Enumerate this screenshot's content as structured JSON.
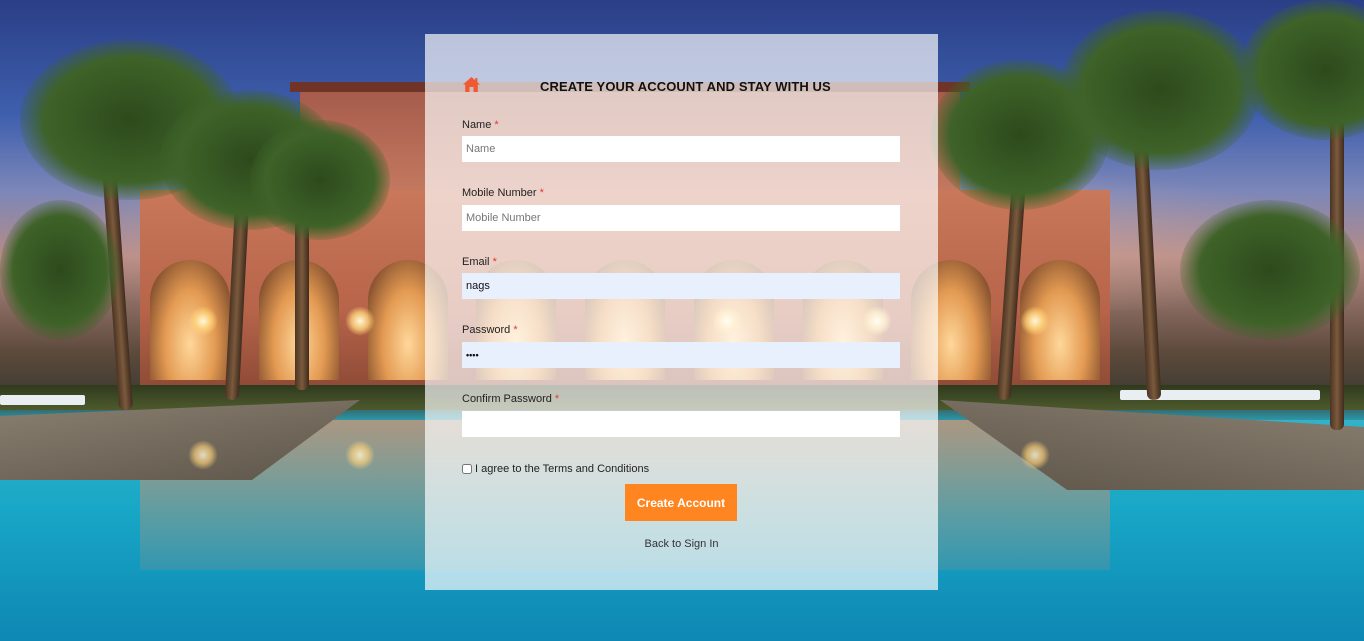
{
  "form": {
    "title": "CREATE YOUR ACCOUNT AND STAY WITH US",
    "required_marker": "*",
    "fields": {
      "name": {
        "label": "Name",
        "placeholder": "Name",
        "value": ""
      },
      "mobile": {
        "label": "Mobile Number",
        "placeholder": "Mobile Number",
        "value": ""
      },
      "email": {
        "label": "Email",
        "placeholder": "",
        "value": "nags"
      },
      "password": {
        "label": "Password",
        "placeholder": "",
        "value": "••••"
      },
      "confirm_password": {
        "label": "Confirm Password",
        "placeholder": "",
        "value": ""
      }
    },
    "terms_label": "I agree to the Terms and Conditions",
    "terms_checked": false,
    "submit_label": "Create Account",
    "back_link": "Back to Sign In"
  },
  "icons": {
    "home": "home-icon"
  },
  "colors": {
    "accent": "#ff8520",
    "home_icon": "#ef5a35",
    "required": "#e53935",
    "autofill_bg": "#e8f0fe"
  }
}
